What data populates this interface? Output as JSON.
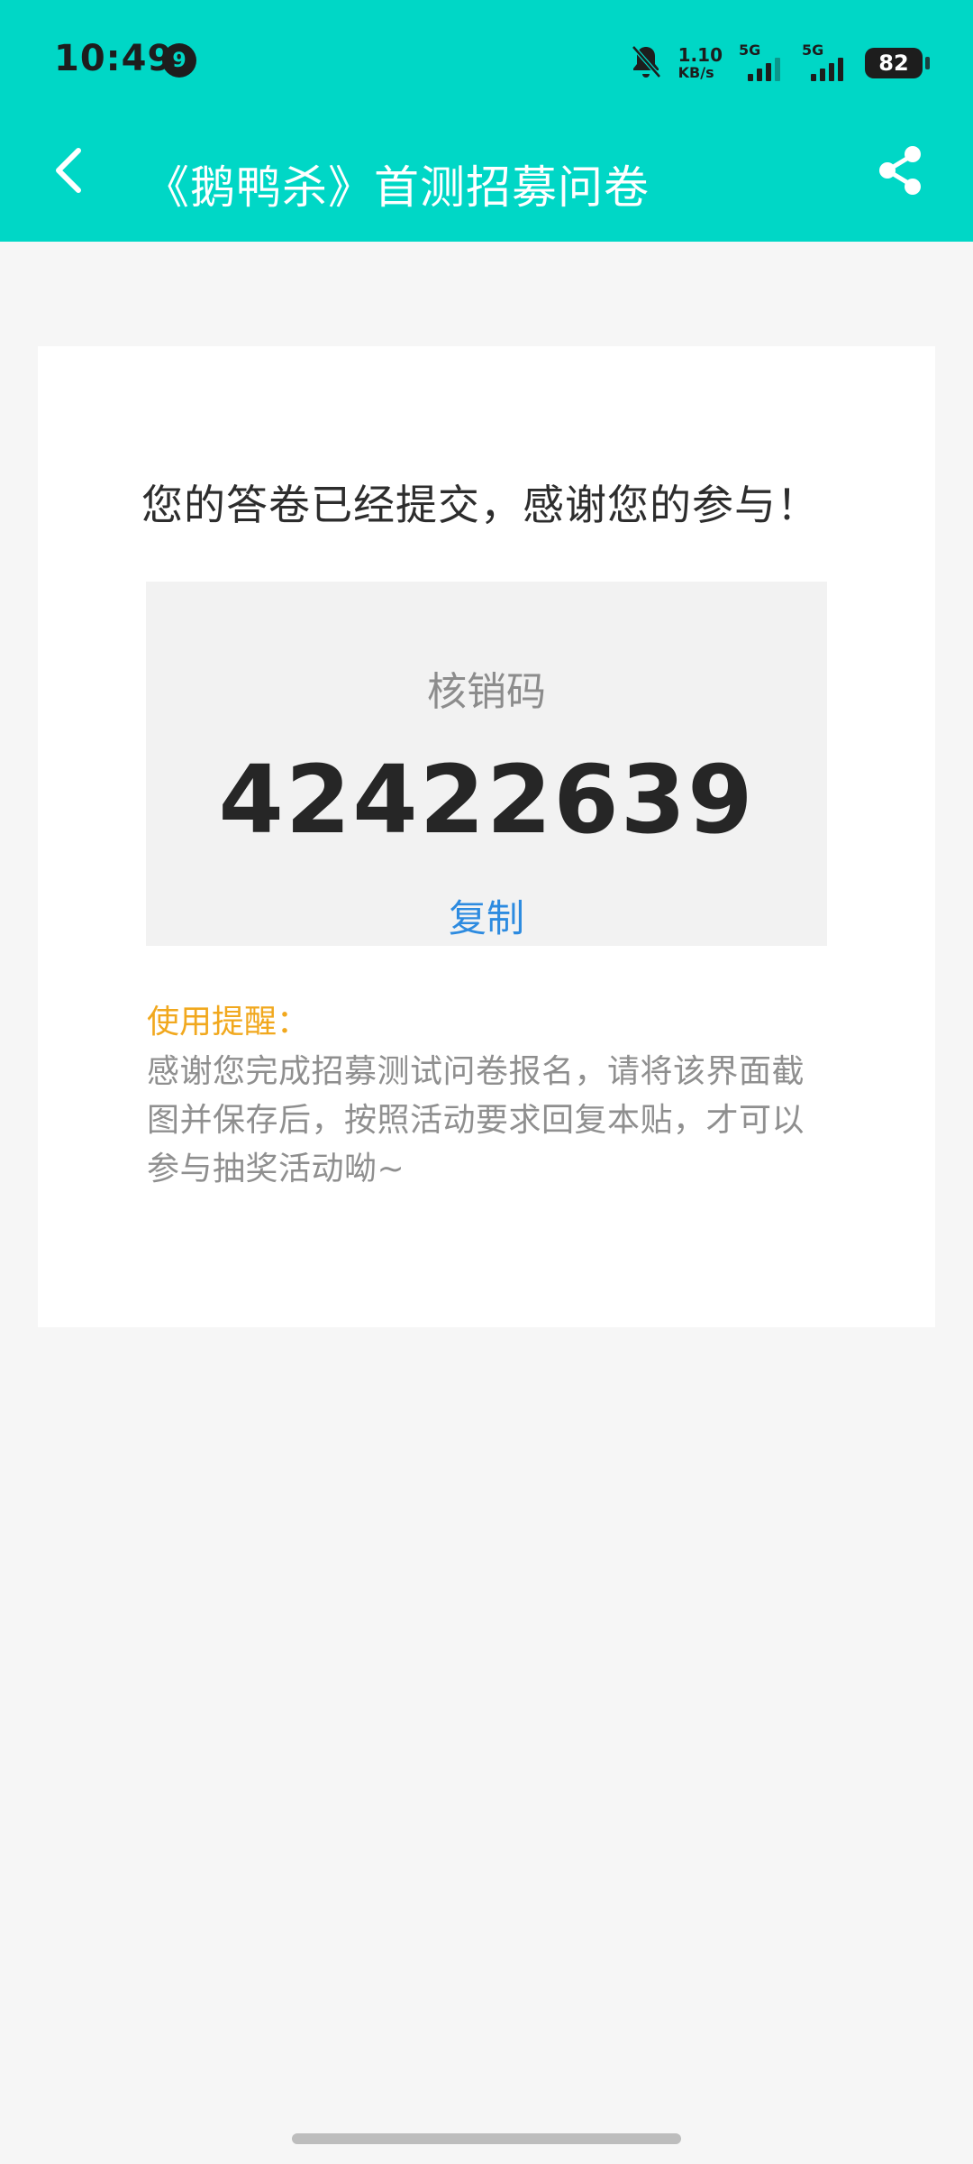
{
  "status_bar": {
    "time": "10:49",
    "notification_badge": "9",
    "network_speed_value": "1.10",
    "network_speed_unit": "KB/s",
    "signal_1_label": "5G",
    "signal_2_label": "5G",
    "battery_level": "82",
    "icons": [
      "bell-muted-icon",
      "signal-icon",
      "battery-icon"
    ]
  },
  "header": {
    "title": "《鹅鸭杀》首测招募问卷",
    "back_icon": "chevron-left-icon",
    "share_icon": "share-icon",
    "background_color": "#00d7c6"
  },
  "result_card": {
    "success_message": "您的答卷已经提交，感谢您的参与！",
    "code_label": "核销码",
    "code_value": "42422639",
    "copy_label": "复制",
    "tip_title": "使用提醒：",
    "tip_body": "感谢您完成招募测试问卷报名，请将该界面截图并保存后，按照活动要求回复本贴，才可以参与抽奖活动呦~",
    "accent_colors": {
      "copy_link": "#2d8be0",
      "tip_title": "#f1a81e"
    }
  }
}
